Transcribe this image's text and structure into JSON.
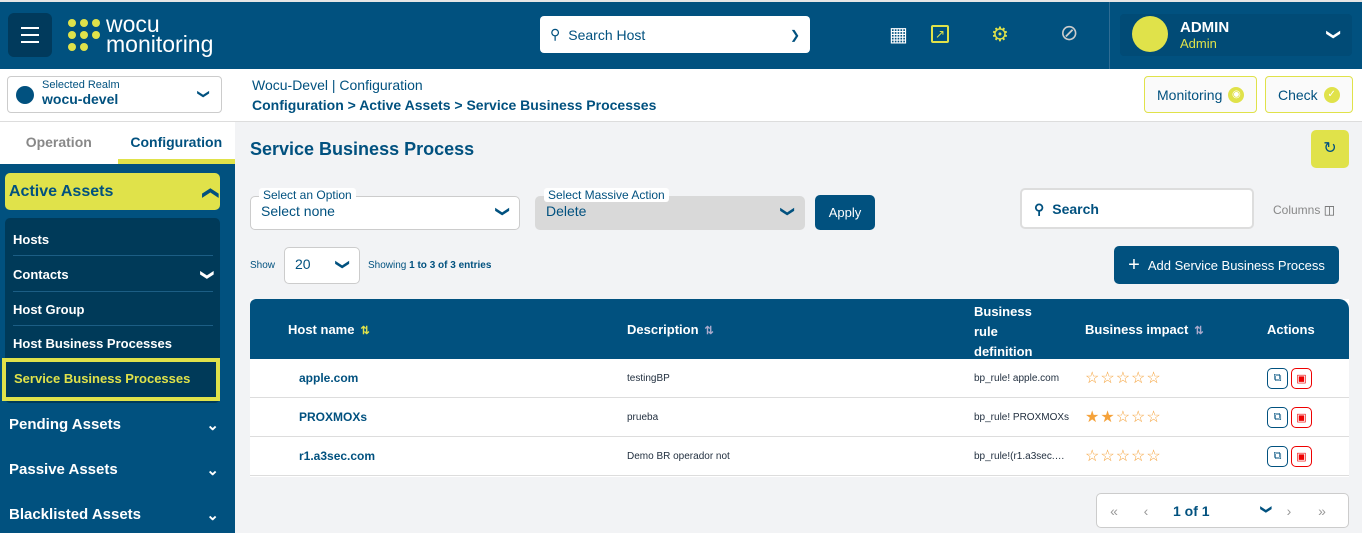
{
  "header": {
    "logo_line1": "wocu",
    "logo_line2": "monitoring",
    "search_placeholder": "Search Host",
    "user_name": "ADMIN",
    "user_role": "Admin"
  },
  "realm": {
    "label": "Selected Realm",
    "value": "wocu-devel"
  },
  "breadcrumb": {
    "top": "Wocu-Devel | Configuration",
    "path": "Configuration > Active Assets > Service Business Processes"
  },
  "top_buttons": {
    "monitoring": "Monitoring",
    "check": "Check"
  },
  "sidebar": {
    "tabs": [
      "Operation",
      "Configuration"
    ],
    "active_group": "Active Assets",
    "items": [
      "Hosts",
      "Contacts",
      "Host Group",
      "Host Business Processes",
      "Service Business Processes"
    ],
    "groups": [
      "Pending Assets",
      "Passive Assets",
      "Blacklisted Assets"
    ]
  },
  "main": {
    "title": "Service Business Process",
    "option_label": "Select an Option",
    "option_value": "Select none",
    "massive_label": "Select Massive Action",
    "massive_value": "Delete",
    "apply": "Apply",
    "search_placeholder": "Search",
    "columns": "Columns",
    "show": "Show",
    "page_size": "20",
    "showing_pre": "Showing ",
    "showing_bold": "1 to 3 of 3 entries",
    "add_button": "Add Service Business Process"
  },
  "table": {
    "headers": [
      "Host name",
      "Description",
      "Business rule definition",
      "Business impact",
      "Actions"
    ],
    "rows": [
      {
        "host": "apple.com",
        "description": "testingBP",
        "rule": "bp_rule! apple.com",
        "impact": 0
      },
      {
        "host": "PROXMOXs",
        "description": "prueba",
        "rule": "bp_rule! PROXMOXs",
        "impact": 2
      },
      {
        "host": "r1.a3sec.com",
        "description": "Demo BR operador not",
        "rule": "bp_rule!(r1.a3sec.…",
        "impact": 0
      }
    ]
  },
  "pagination": {
    "page": "1 of 1"
  },
  "colors": {
    "primary": "#01517f",
    "accent": "#e0e24a",
    "star": "#f5a23a",
    "delete": "#e00000"
  }
}
